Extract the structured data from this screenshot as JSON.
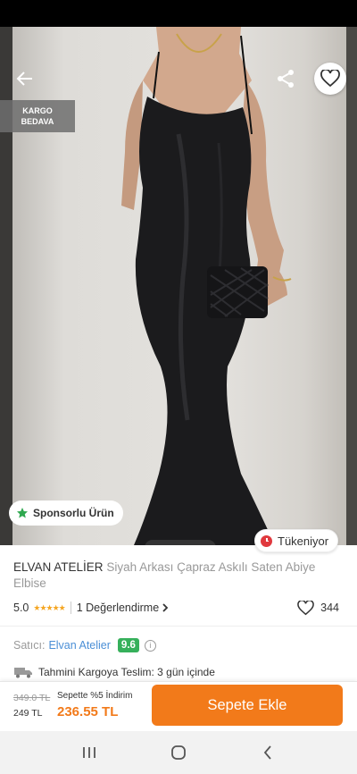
{
  "header": {
    "cargo_badge_line1": "KARGO",
    "cargo_badge_line2": "BEDAVA",
    "icons": [
      "back-arrow-icon",
      "share-icon",
      "heart-icon"
    ]
  },
  "gallery": {
    "sponsored_label": "Sponsorlu Ürün",
    "stock_label": "Tükeniyor",
    "dot_count": 5,
    "active_index": 0
  },
  "product": {
    "brand": "ELVAN ATELİER",
    "name": "Siyah Arkası Çapraz Askılı Saten Abiye Elbise",
    "rating": "5.0",
    "review_text": "1 Değerlendirme",
    "favorite_count": "344"
  },
  "seller": {
    "label": "Satıcı:",
    "name": "Elvan Atelier",
    "score": "9.6"
  },
  "delivery": {
    "text": "Tahmini Kargoya Teslim: 3 gün içinde"
  },
  "price": {
    "old": "349.0 TL",
    "base": "249 TL",
    "promo_label": "Sepette %5 İndirim",
    "promo": "236.55 TL"
  },
  "actions": {
    "add_to_cart": "Sepete Ekle"
  },
  "colors": {
    "accent": "#f27a1a",
    "seller_link": "#4b8fd6",
    "score_bg": "#36b05b",
    "stock_alert": "#e0393e"
  }
}
